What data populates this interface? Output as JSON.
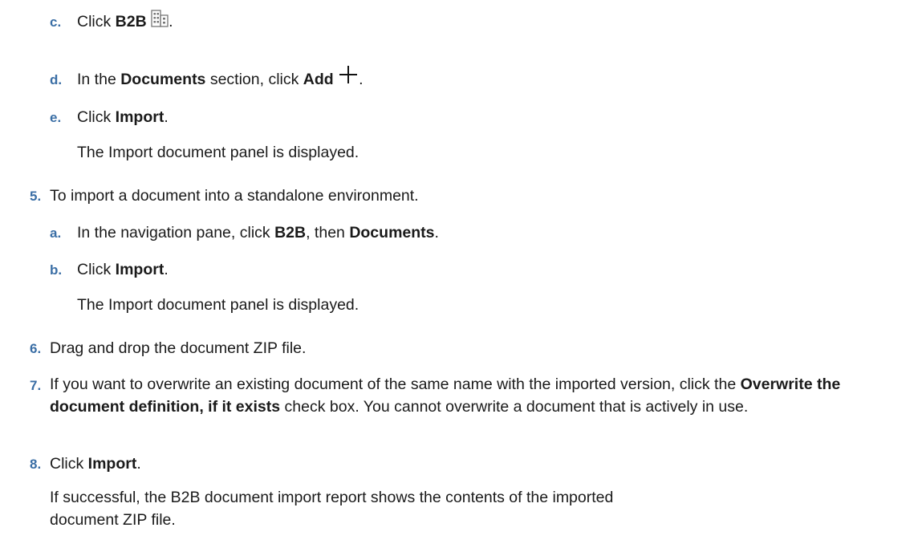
{
  "steps": {
    "c": {
      "marker": "c.",
      "pre": "Click ",
      "b1": "B2B",
      "post": "."
    },
    "d": {
      "marker": "d.",
      "pre": "In the ",
      "b1": "Documents",
      "mid": " section, click ",
      "b2": "Add",
      "post": "."
    },
    "e": {
      "marker": "e.",
      "pre": "Click ",
      "b1": "Import",
      "post": ".",
      "note": "The Import document panel is displayed."
    },
    "s5": {
      "marker": "5.",
      "text": "To import a document into a standalone environment."
    },
    "s5a": {
      "marker": "a.",
      "pre": "In the navigation pane, click ",
      "b1": "B2B",
      "mid": ", then ",
      "b2": "Documents",
      "post": "."
    },
    "s5b": {
      "marker": "b.",
      "pre": "Click ",
      "b1": "Import",
      "post": ".",
      "note": "The Import document panel is displayed."
    },
    "s6": {
      "marker": "6.",
      "text": "Drag and drop the document ZIP file."
    },
    "s7": {
      "marker": "7.",
      "pre": "If you want to overwrite an existing document of the same name with the imported version, click the ",
      "b1": "Overwrite the document definition, if it exists",
      "post": " check box. You cannot overwrite a document that is actively in use."
    },
    "s8": {
      "marker": "8.",
      "pre": "Click ",
      "b1": "Import",
      "post": ".",
      "note": "If successful, the B2B document import report shows the contents of the imported document ZIP file."
    }
  },
  "icons": {
    "b2b": "building-icon",
    "add": "plus-icon"
  },
  "colors": {
    "marker": "#3a6ea5",
    "text": "#1a1a1a"
  }
}
